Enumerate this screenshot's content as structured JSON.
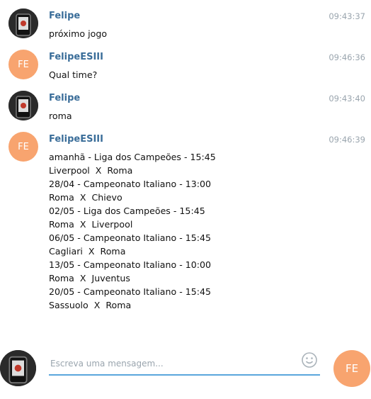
{
  "messages": [
    {
      "sender": "Felipe",
      "time": "09:43:37",
      "avatar": "photo",
      "lines": [
        "próximo jogo"
      ]
    },
    {
      "sender": "FelipeESIII",
      "time": "09:46:36",
      "avatar": "initials",
      "initials": "FE",
      "lines": [
        "Qual time?"
      ]
    },
    {
      "sender": "Felipe",
      "time": "09:43:40",
      "avatar": "photo",
      "lines": [
        "roma"
      ]
    },
    {
      "sender": "FelipeESIII",
      "time": "09:46:39",
      "avatar": "initials",
      "initials": "FE",
      "lines": [
        "amanhã - Liga dos Campeões - 15:45",
        "Liverpool  X  Roma",
        "28/04 - Campeonato Italiano - 13:00",
        "Roma  X  Chievo",
        "02/05 - Liga dos Campeões - 15:45",
        "Roma  X  Liverpool",
        "06/05 - Campeonato Italiano - 15:45",
        "Cagliari  X  Roma",
        "13/05 - Campeonato Italiano - 10:00",
        "Roma  X  Juventus",
        "20/05 - Campeonato Italiano - 15:45",
        "Sassuolo  X  Roma"
      ]
    }
  ],
  "composer": {
    "placeholder": "Escreva uma mensagem...",
    "send_initials": "FE"
  },
  "icons": {
    "emoji": "smiley-icon"
  },
  "colors": {
    "sender": "#3a6d99",
    "avatar_bg": "#f8a46f",
    "input_underline": "#5aa6dc",
    "timestamp": "#9aa5ae"
  }
}
